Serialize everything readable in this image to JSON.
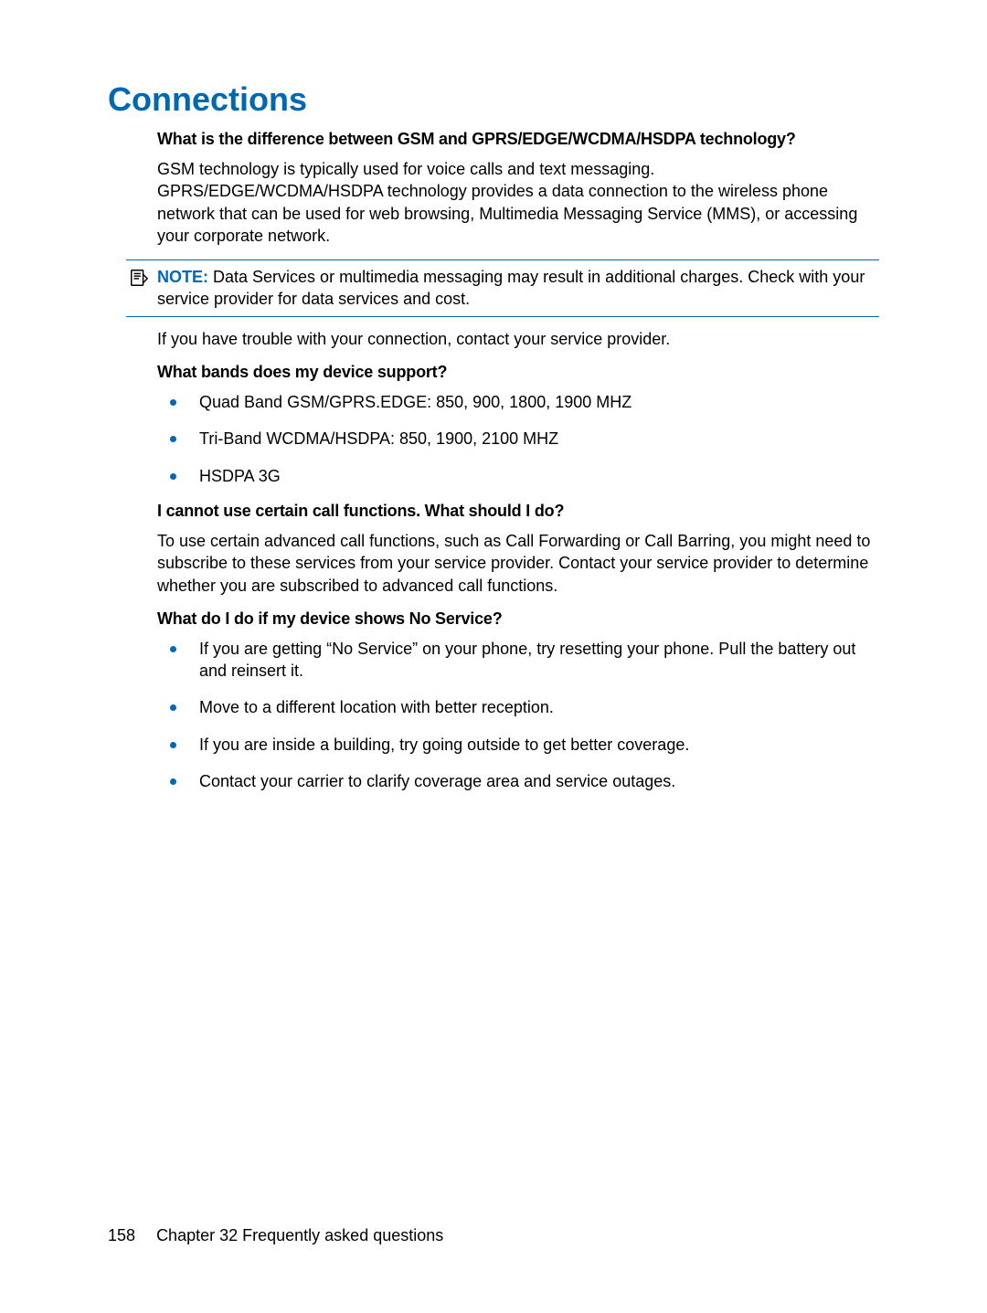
{
  "heading": "Connections",
  "q1": {
    "title": "What is the difference between GSM and GPRS/EDGE/WCDMA/HSDPA technology?",
    "para": "GSM technology is typically used for voice calls and text messaging. GPRS/EDGE/WCDMA/HSDPA technology provides a data connection to the wireless phone network that can be used for web browsing, Multimedia Messaging Service (MMS), or accessing your corporate network."
  },
  "note": {
    "label": "NOTE:",
    "text": "Data Services or multimedia messaging may result in additional charges. Check with your service provider for data services and cost."
  },
  "after_note_para": "If you have trouble with your connection, contact your service provider.",
  "q2": {
    "title": "What bands does my device support?",
    "items": [
      "Quad Band GSM/GPRS.EDGE: 850, 900, 1800, 1900 MHZ",
      "Tri-Band WCDMA/HSDPA: 850, 1900, 2100 MHZ",
      "HSDPA 3G"
    ]
  },
  "q3": {
    "title": "I cannot use certain call functions. What should I do?",
    "para": "To use certain advanced call functions, such as Call Forwarding or Call Barring, you might need to subscribe to these services from your service provider. Contact your service provider to determine whether you are subscribed to advanced call functions."
  },
  "q4": {
    "title": "What do I do if my device shows No Service?",
    "items": [
      "If you are getting “No Service” on your phone, try resetting your phone. Pull the battery out and reinsert it.",
      "Move to a different location with better reception.",
      "If you are inside a building, try going outside to get better coverage.",
      "Contact your carrier to clarify coverage area and service outages."
    ]
  },
  "footer": {
    "page": "158",
    "chapter": "Chapter 32   Frequently asked questions"
  }
}
